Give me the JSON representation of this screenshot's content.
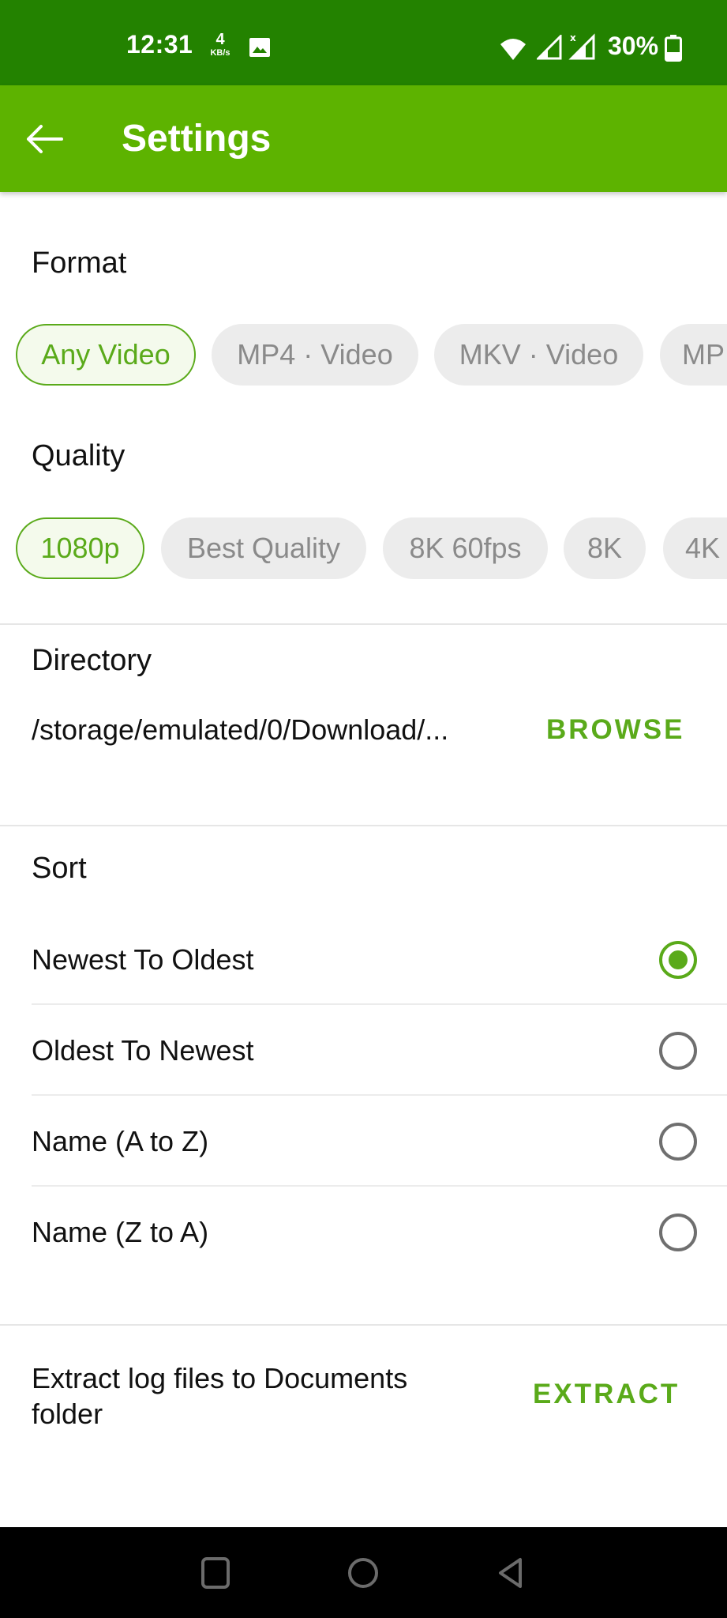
{
  "status_bar": {
    "time": "12:31",
    "net_speed_value": "4",
    "net_speed_unit": "KB/s",
    "battery_percent": "30%",
    "icons": [
      "gallery-icon",
      "wifi-icon",
      "signal-icon",
      "signal-no-data-icon",
      "battery-icon"
    ]
  },
  "app_bar": {
    "title": "Settings",
    "back_icon": "arrow-left-icon"
  },
  "format": {
    "title": "Format",
    "chips": [
      {
        "label": "Any Video",
        "selected": true
      },
      {
        "label": "MP4 · Video",
        "selected": false
      },
      {
        "label": "MKV · Video",
        "selected": false
      },
      {
        "label": "MP",
        "selected": false
      }
    ]
  },
  "quality": {
    "title": "Quality",
    "chips": [
      {
        "label": "1080p",
        "selected": true
      },
      {
        "label": "Best Quality",
        "selected": false
      },
      {
        "label": "8K 60fps",
        "selected": false
      },
      {
        "label": "8K",
        "selected": false
      },
      {
        "label": "4K",
        "selected": false
      }
    ]
  },
  "directory": {
    "title": "Directory",
    "path": "/storage/emulated/0/Download/...",
    "browse_label": "BROWSE"
  },
  "sort": {
    "title": "Sort",
    "options": [
      {
        "label": "Newest To Oldest",
        "checked": true
      },
      {
        "label": "Oldest To Newest",
        "checked": false
      },
      {
        "label": "Name (A to Z)",
        "checked": false
      },
      {
        "label": "Name (Z to A)",
        "checked": false
      }
    ]
  },
  "logs": {
    "label": "Extract log files to Documents folder",
    "extract_label": "EXTRACT"
  },
  "nav_bar": {
    "buttons": [
      "recents-icon",
      "home-icon",
      "back-icon"
    ]
  },
  "colors": {
    "status_bar": "#238200",
    "app_bar": "#5db300",
    "accent": "#5aaa1a",
    "chip_bg": "#ececec",
    "chip_text": "#8a8a8a"
  }
}
